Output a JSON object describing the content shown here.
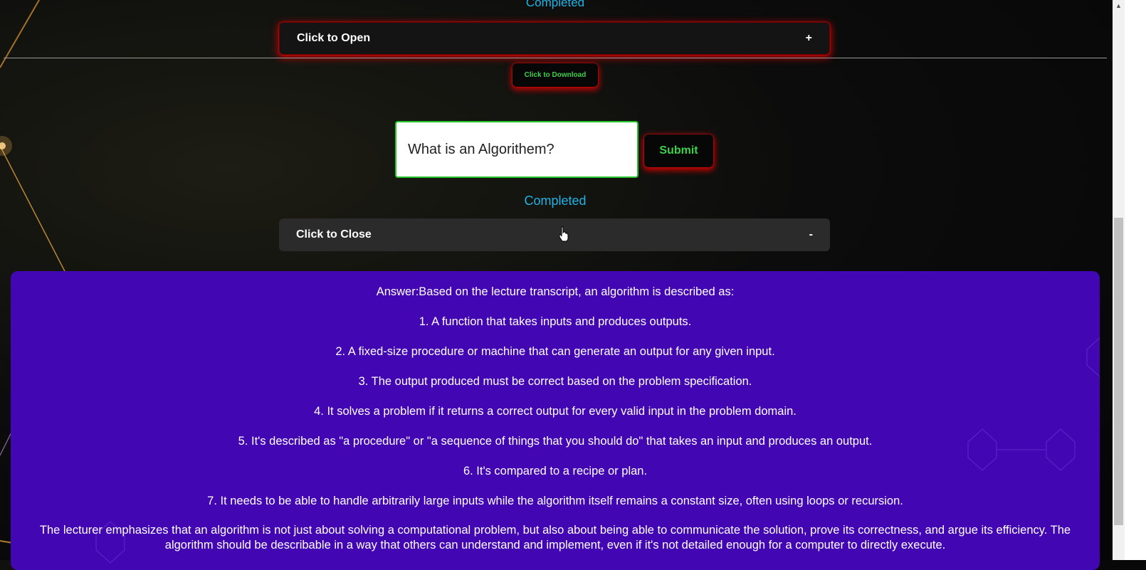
{
  "top_status": "Completed",
  "open_accordion": {
    "label": "Click to Open",
    "sign": "+"
  },
  "download_button": "Click to Download",
  "question": {
    "value": "What is an Algorithem?"
  },
  "submit_button": "Submit",
  "status": "Completed",
  "close_accordion": {
    "label": "Click to Close",
    "sign": "-"
  },
  "answer": {
    "lines": [
      "Answer:Based on the lecture transcript, an algorithm is described as:",
      "1. A function that takes inputs and produces outputs.",
      "2. A fixed-size procedure or machine that can generate an output for any given input.",
      "3. The output produced must be correct based on the problem specification.",
      "4. It solves a problem if it returns a correct output for every valid input in the problem domain.",
      "5. It's described as \"a procedure\" or \"a sequence of things that you should do\" that takes an input and produces an output.",
      "6. It's compared to a recipe or plan.",
      "7. It needs to be able to handle arbitrarily large inputs while the algorithm itself remains a constant size, often using loops or recursion."
    ],
    "summary": "The lecturer emphasizes that an algorithm is not just about solving a computational problem, but also about being able to communicate the solution, prove its correctness, and argue its efficiency. The algorithm should be describable in a way that others can understand and implement, even if it's not detailed enough for a computer to directly execute."
  },
  "colors": {
    "status_text": "#21b3e6",
    "answer_panel": "#4306b3",
    "button_text": "#3ed04a",
    "button_glow": "#e01010",
    "input_border": "#25c22b"
  },
  "icons": [
    "pointer-cursor-icon",
    "scroll-up-arrow-icon"
  ]
}
